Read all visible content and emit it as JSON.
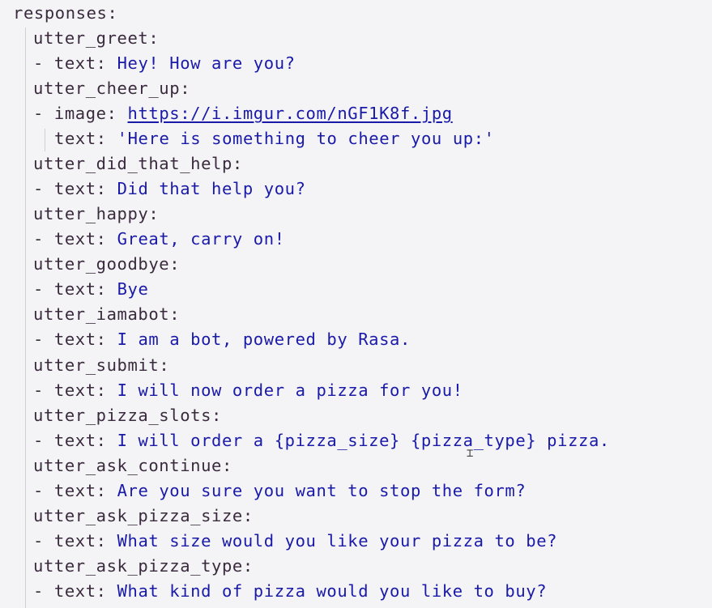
{
  "root_key": "responses",
  "responses": [
    {
      "name": "utter_greet",
      "items": [
        {
          "text": "Hey! How are you?"
        }
      ]
    },
    {
      "name": "utter_cheer_up",
      "items": [
        {
          "image": "https://i.imgur.com/nGF1K8f.jpg",
          "text": "'Here is something to cheer you up:'"
        }
      ]
    },
    {
      "name": "utter_did_that_help",
      "items": [
        {
          "text": "Did that help you?"
        }
      ]
    },
    {
      "name": "utter_happy",
      "items": [
        {
          "text": "Great, carry on!"
        }
      ]
    },
    {
      "name": "utter_goodbye",
      "items": [
        {
          "text": "Bye"
        }
      ]
    },
    {
      "name": "utter_iamabot",
      "items": [
        {
          "text": "I am a bot, powered by Rasa."
        }
      ]
    },
    {
      "name": "utter_submit",
      "items": [
        {
          "text": "I will now order a pizza for you!"
        }
      ]
    },
    {
      "name": "utter_pizza_slots",
      "items": [
        {
          "text": "I will order a {pizza_size} {pizza_type} pizza."
        }
      ]
    },
    {
      "name": "utter_ask_continue",
      "items": [
        {
          "text": "Are you sure you want to stop the form?"
        }
      ]
    },
    {
      "name": "utter_ask_pizza_size",
      "items": [
        {
          "text": "What size would you like your pizza to be?"
        }
      ]
    },
    {
      "name": "utter_ask_pizza_type",
      "items": [
        {
          "text": "What kind of pizza would you like to buy?"
        }
      ]
    }
  ],
  "field_keys": {
    "text": "text",
    "image": "image"
  },
  "colors": {
    "key": "#3a2a3e",
    "value": "#1a1aa8",
    "background": "#f4f4f6",
    "guide": "#cfcfd6"
  }
}
